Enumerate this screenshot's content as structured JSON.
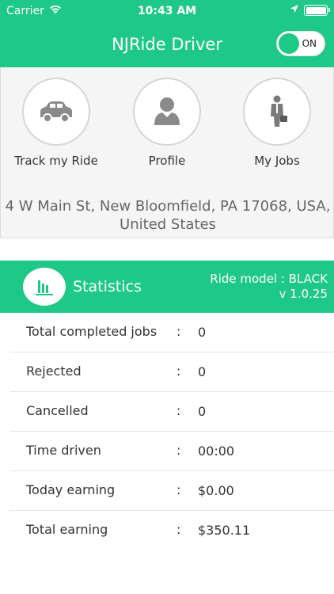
{
  "status_bar": {
    "carrier": "Carrier",
    "time": "10:43 AM"
  },
  "header": {
    "title": "NJRide Driver",
    "toggle_label": "ON"
  },
  "nav": [
    {
      "label": "Track my Ride",
      "icon": "car-icon"
    },
    {
      "label": "Profile",
      "icon": "person-icon"
    },
    {
      "label": "My Jobs",
      "icon": "briefcase-person-icon"
    }
  ],
  "address": "4 W Main St, New Bloomfield, PA 17068, USA, United States",
  "stats": {
    "title": "Statistics",
    "ride_model": "Ride model : BLACK",
    "version": "v 1.0.25",
    "rows": [
      {
        "label": "Total completed jobs",
        "sep": ":",
        "value": "0"
      },
      {
        "label": "Rejected",
        "sep": ":",
        "value": "0"
      },
      {
        "label": "Cancelled",
        "sep": ":",
        "value": "0"
      },
      {
        "label": "Time driven",
        "sep": ":",
        "value": "00:00"
      },
      {
        "label": "Today earning",
        "sep": ":",
        "value": "$0.00"
      },
      {
        "label": "Total earning",
        "sep": ":",
        "value": "$350.11"
      }
    ]
  },
  "colors": {
    "accent": "#1ec886",
    "panel_bg": "#f5f5f5",
    "icon_gray": "#8a8a8a"
  }
}
